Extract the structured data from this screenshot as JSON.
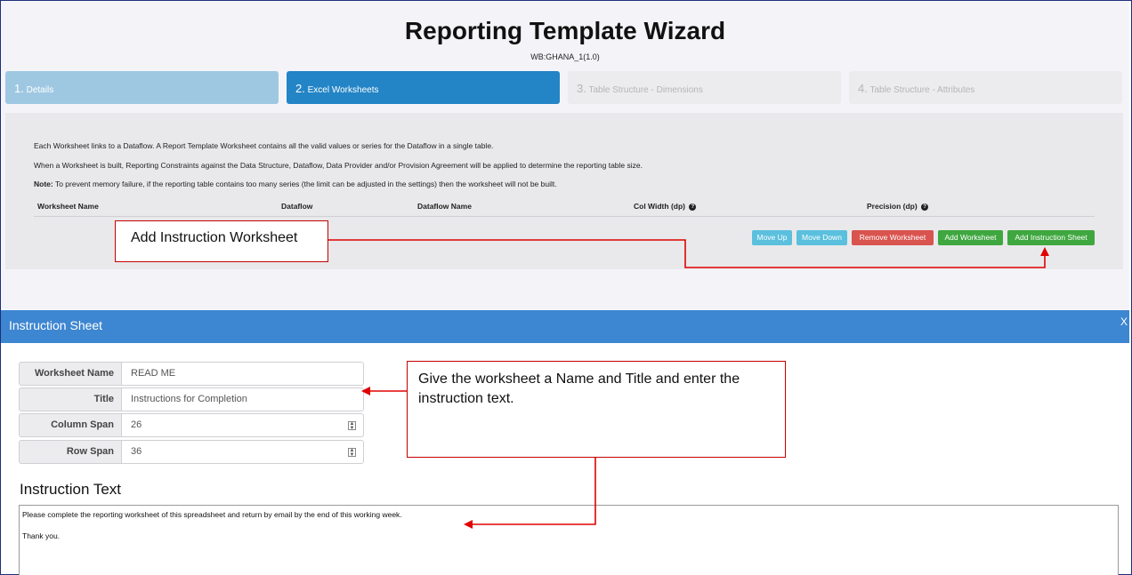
{
  "wizard": {
    "title": "Reporting Template Wizard",
    "subtitle": "WB:GHANA_1(1.0)",
    "steps": [
      {
        "num": "1.",
        "label": "Details"
      },
      {
        "num": "2.",
        "label": "Excel Worksheets"
      },
      {
        "num": "3.",
        "label": "Table Structure - Dimensions"
      },
      {
        "num": "4.",
        "label": "Table Structure - Attributes"
      }
    ],
    "paragraphs": {
      "p1": "Each Worksheet links to a Dataflow. A Report Template Worksheet contains all the valid values or series for the Dataflow in a single table.",
      "p2": "When a Worksheet is built, Reporting Constraints against the Data Structure, Dataflow, Data Provider and/or Provision Agreement will be applied to determine the reporting table size.",
      "p3_label": "Note:",
      "p3_text": " To prevent memory failure, if the reporting table contains too many series (the limit can be adjusted in the settings) then the worksheet will not be built."
    },
    "columns": {
      "worksheet_name": "Worksheet Name",
      "dataflow": "Dataflow",
      "dataflow_name": "Dataflow Name",
      "col_width": "Col Width (dp)",
      "precision": "Precision (dp)"
    },
    "buttons": {
      "move_up": "Move Up",
      "move_down": "Move Down",
      "remove": "Remove Worksheet",
      "add": "Add Worksheet",
      "add_instruction": "Add Instruction Sheet"
    }
  },
  "callouts": {
    "add_instruction": "Add Instruction Worksheet",
    "name_title": "Give the worksheet a Name and Title and enter the instruction text."
  },
  "dialog": {
    "title": "Instruction Sheet",
    "close": "X",
    "fields": {
      "worksheet_name": {
        "label": "Worksheet Name",
        "value": "READ ME"
      },
      "title": {
        "label": "Title",
        "value": "Instructions for Completion"
      },
      "column_span": {
        "label": "Column Span",
        "value": "26"
      },
      "row_span": {
        "label": "Row Span",
        "value": "36"
      }
    },
    "instruction_heading": "Instruction Text",
    "instruction_line1": "Please complete the reporting worksheet of this spreadsheet and return by email by the end of this working week.",
    "instruction_line2": "Thank you."
  },
  "colors": {
    "active_step": "#2384c6",
    "done_step": "#9ec8e2",
    "dialog_header": "#3d86d1",
    "callout_border": "#c40000",
    "btn_info": "#5bc0de",
    "btn_danger": "#d9534f",
    "btn_success": "#3fa73f"
  }
}
